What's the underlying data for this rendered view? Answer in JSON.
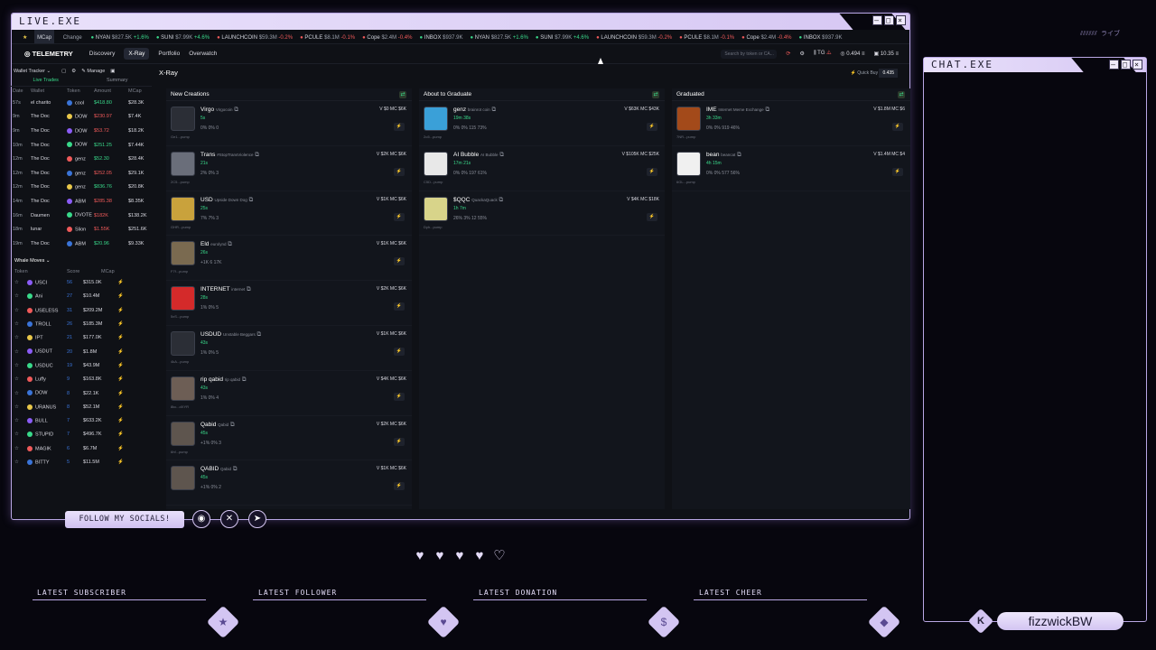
{
  "main_window": {
    "title": "LIVE.EXE"
  },
  "chat_window": {
    "title": "CHAT.EXE"
  },
  "ticker": [
    {
      "name": "NYAN",
      "mc": "$827.5K",
      "chg": "+1.6%",
      "dir": "up"
    },
    {
      "name": "SUNI",
      "mc": "$7.99K",
      "chg": "+4.6%",
      "dir": "up"
    },
    {
      "name": "LAUNCHCOIN",
      "mc": "$59.3M",
      "chg": "-0.2%",
      "dir": "dn"
    },
    {
      "name": "PCULE",
      "mc": "$8.1M",
      "chg": "-0.1%",
      "dir": "dn"
    },
    {
      "name": "Cope",
      "mc": "$2.4M",
      "chg": "-0.4%",
      "dir": "dn"
    },
    {
      "name": "INBOX",
      "mc": "$937.9K",
      "chg": "",
      "dir": "up"
    },
    {
      "name": "NYAN",
      "mc": "$827.5K",
      "chg": "+1.6%",
      "dir": "up"
    },
    {
      "name": "SUNI",
      "mc": "$7.99K",
      "chg": "+4.6%",
      "dir": "up"
    },
    {
      "name": "LAUNCHCOIN",
      "mc": "$59.3M",
      "chg": "-0.2%",
      "dir": "dn"
    },
    {
      "name": "PCULE",
      "mc": "$8.1M",
      "chg": "-0.1%",
      "dir": "dn"
    },
    {
      "name": "Cope",
      "mc": "$2.4M",
      "chg": "-0.4%",
      "dir": "dn"
    },
    {
      "name": "INBOX",
      "mc": "$937.9K",
      "chg": "",
      "dir": "up"
    }
  ],
  "ticker_labels": {
    "mcap": "MCap",
    "change": "Change"
  },
  "nav": {
    "logo": "TELEMETRY",
    "items": [
      "Discovery",
      "X-Ray",
      "Portfolio",
      "Overwatch"
    ],
    "search_placeholder": "Search by token or CA...",
    "balance1": "0.494",
    "balance2": "10.35",
    "tg": "TG"
  },
  "sidebar": {
    "title": "Wallet Tracker",
    "manage": "Manage",
    "tabs": [
      "Live Trades",
      "Summary"
    ],
    "trade_cols": [
      "Date",
      "Wallet",
      "Token",
      "Amount",
      "MCap"
    ],
    "trades": [
      {
        "date": "57s",
        "wallet": "el charito",
        "token": "cool",
        "amount": "$418.80",
        "mcap": "$28.3K",
        "dir": "green"
      },
      {
        "date": "9m",
        "wallet": "The Doc",
        "token": "DOW",
        "amount": "$230.97",
        "mcap": "$7.4K",
        "dir": "red"
      },
      {
        "date": "9m",
        "wallet": "The Doc",
        "token": "DOW",
        "amount": "$53.72",
        "mcap": "$18.2K",
        "dir": "red"
      },
      {
        "date": "10m",
        "wallet": "The Doc",
        "token": "DOW",
        "amount": "$251.25",
        "mcap": "$7.44K",
        "dir": "green"
      },
      {
        "date": "12m",
        "wallet": "The Doc",
        "token": "genz",
        "amount": "$52.30",
        "mcap": "$28.4K",
        "dir": "green"
      },
      {
        "date": "12m",
        "wallet": "The Doc",
        "token": "genz",
        "amount": "$252.05",
        "mcap": "$29.1K",
        "dir": "red"
      },
      {
        "date": "12m",
        "wallet": "The Doc",
        "token": "genz",
        "amount": "$836.76",
        "mcap": "$20.8K",
        "dir": "green"
      },
      {
        "date": "14m",
        "wallet": "The Doc",
        "token": "ABM",
        "amount": "$285.38",
        "mcap": "$8.35K",
        "dir": "red"
      },
      {
        "date": "16m",
        "wallet": "Daumen",
        "token": "DVOTE",
        "amount": "$182K",
        "mcap": "$138.2K",
        "dir": "red"
      },
      {
        "date": "18m",
        "wallet": "lunar",
        "token": "Slion",
        "amount": "$1.55K",
        "mcap": "$251.6K",
        "dir": "red"
      },
      {
        "date": "19m",
        "wallet": "The Doc",
        "token": "ABM",
        "amount": "$20.96",
        "mcap": "$9.33K",
        "dir": "green"
      }
    ],
    "whale_title": "Whale Moves",
    "whale_cols": [
      "Token",
      "Score",
      "MCap"
    ],
    "whales": [
      {
        "token": "USCI",
        "score": "56",
        "mcap": "$315.0K"
      },
      {
        "token": "Ani",
        "score": "27",
        "mcap": "$10.4M"
      },
      {
        "token": "USELESS",
        "score": "31",
        "mcap": "$209.2M"
      },
      {
        "token": "TROLL",
        "score": "26",
        "mcap": "$185.3M"
      },
      {
        "token": "IPT",
        "score": "21",
        "mcap": "$177.0K"
      },
      {
        "token": "USDUT",
        "score": "20",
        "mcap": "$1.8M"
      },
      {
        "token": "USDUC",
        "score": "19",
        "mcap": "$43.9M"
      },
      {
        "token": "Luffy",
        "score": "9",
        "mcap": "$163.8K"
      },
      {
        "token": "DOW",
        "score": "8",
        "mcap": "$22.1K"
      },
      {
        "token": "URANUS",
        "score": "8",
        "mcap": "$52.1M"
      },
      {
        "token": "BULL",
        "score": "7",
        "mcap": "$633.2K"
      },
      {
        "token": "STUPID",
        "score": "7",
        "mcap": "$496.7K"
      },
      {
        "token": "MAGIK",
        "score": "6",
        "mcap": "$6.7M"
      },
      {
        "token": "BITTY",
        "score": "5",
        "mcap": "$11.5M"
      }
    ]
  },
  "xray": {
    "title": "X-Ray",
    "quick_buy": "Quick Buy",
    "quick_amount": "0.435",
    "columns": [
      {
        "title": "New Creations",
        "tokens": [
          {
            "name": "Virgo",
            "sub": "Virgocoin",
            "age": "5s",
            "stats": "0% 0% 0",
            "val": "V $0  MC $6K",
            "addr": "Ge1...pump"
          },
          {
            "name": "Trans",
            "sub": "#StopTransViolence",
            "age": "21s",
            "stats": "2% 0% 3",
            "val": "V $2K  MC $6K",
            "addr": "2C5...pump"
          },
          {
            "name": "USD",
            "sub": "Upside Down Dog",
            "age": "25s",
            "stats": "7% 7% 3",
            "val": "V $1K  MC $6K",
            "addr": "GHR...pump"
          },
          {
            "name": "Eld",
            "sub": "eurolynd",
            "age": "26s",
            "stats": "+1K 6 17K",
            "val": "V $1K  MC $6K",
            "addr": "F7f...pump"
          },
          {
            "name": "INTERNET",
            "sub": "internet",
            "age": "28s",
            "stats": "1% 0% 5",
            "val": "V $2K  MC $6K",
            "addr": "5xS...pump"
          },
          {
            "name": "USDUD",
            "sub": "Unstable Beggars",
            "age": "43s",
            "stats": "1% 0% 5",
            "val": "V $1K  MC $6K",
            "addr": "4kA...pump"
          },
          {
            "name": "rip qabid",
            "sub": "rip qabid",
            "age": "43s",
            "stats": "1% 0% 4",
            "val": "V $4K  MC $6K",
            "addr": "8kc...dXYR"
          },
          {
            "name": "Qabid",
            "sub": "Qabid",
            "age": "45s",
            "stats": "+1% 0% 3",
            "val": "V $2K  MC $6K",
            "addr": "6hf...pump"
          },
          {
            "name": "QABID",
            "sub": "Qabid",
            "age": "45s",
            "stats": "+1% 0% 2",
            "val": "V $1K  MC $6K",
            "addr": ""
          }
        ]
      },
      {
        "title": "About to Graduate",
        "tokens": [
          {
            "name": "genz",
            "sub": "brainrot coin",
            "age": "19m 38s",
            "stats": "0% 0% 115 73%",
            "val": "V $63K  MC $43K",
            "addr": "2o5...pump"
          },
          {
            "name": "AI Bubble",
            "sub": "AI Bubble",
            "age": "17m 21s",
            "stats": "0% 0% 197 61%",
            "val": "V $105K  MC $25K",
            "addr": "C5D...pump"
          },
          {
            "name": "$QQC",
            "sub": "QuackaQuack",
            "age": "1h 7m",
            "stats": "26% 3% 12 55%",
            "val": "V $4K  MC $18K",
            "addr": "Dyh...pump"
          }
        ]
      },
      {
        "title": "Graduated",
        "tokens": [
          {
            "name": "IME",
            "sub": "Internet Meme Exchange",
            "age": "3h 33m",
            "stats": "0% 0% 919 46%",
            "val": "V $1.8M  MC $6",
            "addr": "7NR...pump"
          },
          {
            "name": "bean",
            "sub": "beancat",
            "age": "4h 15m",
            "stats": "0% 0% 577 56%",
            "val": "V $1.4M  MC $4",
            "addr": "6GL...pump"
          }
        ]
      }
    ]
  },
  "overlay": {
    "follow": "FOLLOW MY SOCIALS!",
    "latest": [
      "LATEST SUBSCRIBER",
      "LATEST FOLLOWER",
      "LATEST DONATION",
      "LATEST CHEER"
    ],
    "handle": "fizzwickBW",
    "deco": "ライブ"
  },
  "colors": {
    "accent": "#d3c5f2",
    "green": "#39d98a",
    "red": "#f05a5a",
    "bg": "#07060e",
    "panel": "#12151c"
  }
}
